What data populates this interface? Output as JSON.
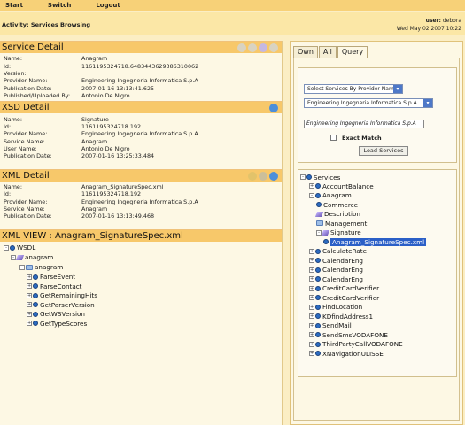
{
  "menu": [
    "Start",
    "Switch",
    "Logout"
  ],
  "activity": "Activity: Services Browsing",
  "user": {
    "label": "user:",
    "name": "debora",
    "date": "Wed May 02 2007 10:22"
  },
  "service_detail": {
    "title": "Service Detail",
    "rows": [
      {
        "k": "Name:",
        "v": "Anagram"
      },
      {
        "k": "Id:",
        "v": "1161195324718.6483443629386310062"
      },
      {
        "k": "Version:",
        "v": ""
      },
      {
        "k": "Provider Name:",
        "v": "Engineering Ingegneria Informatica S.p.A"
      },
      {
        "k": "Publication Date:",
        "v": "2007-01-16 13:13:41.625"
      },
      {
        "k": "Published/Uploaded By:",
        "v": "Antonio De Nigro"
      }
    ]
  },
  "xsd_detail": {
    "title": "XSD Detail",
    "rows": [
      {
        "k": "Name:",
        "v": "Signature"
      },
      {
        "k": "Id:",
        "v": "1161195324718.192"
      },
      {
        "k": "Provider Name:",
        "v": "Engineering Ingegneria Informatica S.p.A"
      },
      {
        "k": "Service Name:",
        "v": "Anagram"
      },
      {
        "k": "User Name:",
        "v": "Antonio De Nigro"
      },
      {
        "k": "Publication Date:",
        "v": "2007-01-16 13:25:33.484"
      }
    ]
  },
  "xml_detail": {
    "title": "XML Detail",
    "rows": [
      {
        "k": "Name:",
        "v": "Anagram_SignatureSpec.xml"
      },
      {
        "k": "Id:",
        "v": "1161195324718.192"
      },
      {
        "k": "Provider Name:",
        "v": "Engineering Ingegneria Informatica S.p.A"
      },
      {
        "k": "Service Name:",
        "v": "Anagram"
      },
      {
        "k": "Publication Date:",
        "v": "2007-01-16 13:13:49.468"
      }
    ]
  },
  "xml_view": {
    "title": "XML VIEW : Anagram_SignatureSpec.xml",
    "nodes": [
      "WSDL",
      "anagram",
      "anagram",
      "ParseEvent",
      "ParseContact",
      "GetRemainingHits",
      "GetParserVersion",
      "GetWSVersion",
      "GetTypeScores"
    ]
  },
  "tabs": [
    "Own",
    "All",
    "Query"
  ],
  "query": {
    "select1": "Select Services By Provider Name",
    "select2": "Engineering Ingegneria Informatica S.p.A",
    "text": "Engineering Ingegneria Informatica S.p.A",
    "exact": "Exact Match",
    "button": "Load Services"
  },
  "services": {
    "root": "Services",
    "items": [
      "AccountBalance",
      "Anagram",
      "Commerce",
      "Description",
      "Management",
      "Signature",
      "Anagram_SignatureSpec.xml",
      "CalculateRate",
      "CalendarEng",
      "CalendarEng",
      "CalendarEng",
      "CreditCardVerifier",
      "CreditCardVerifier",
      "FindLocation",
      "KDfindAddress1",
      "SendMail",
      "SendSmsVODAFONE",
      "ThirdPartyCallVODAFONE",
      "XNavigationULISSE"
    ]
  }
}
